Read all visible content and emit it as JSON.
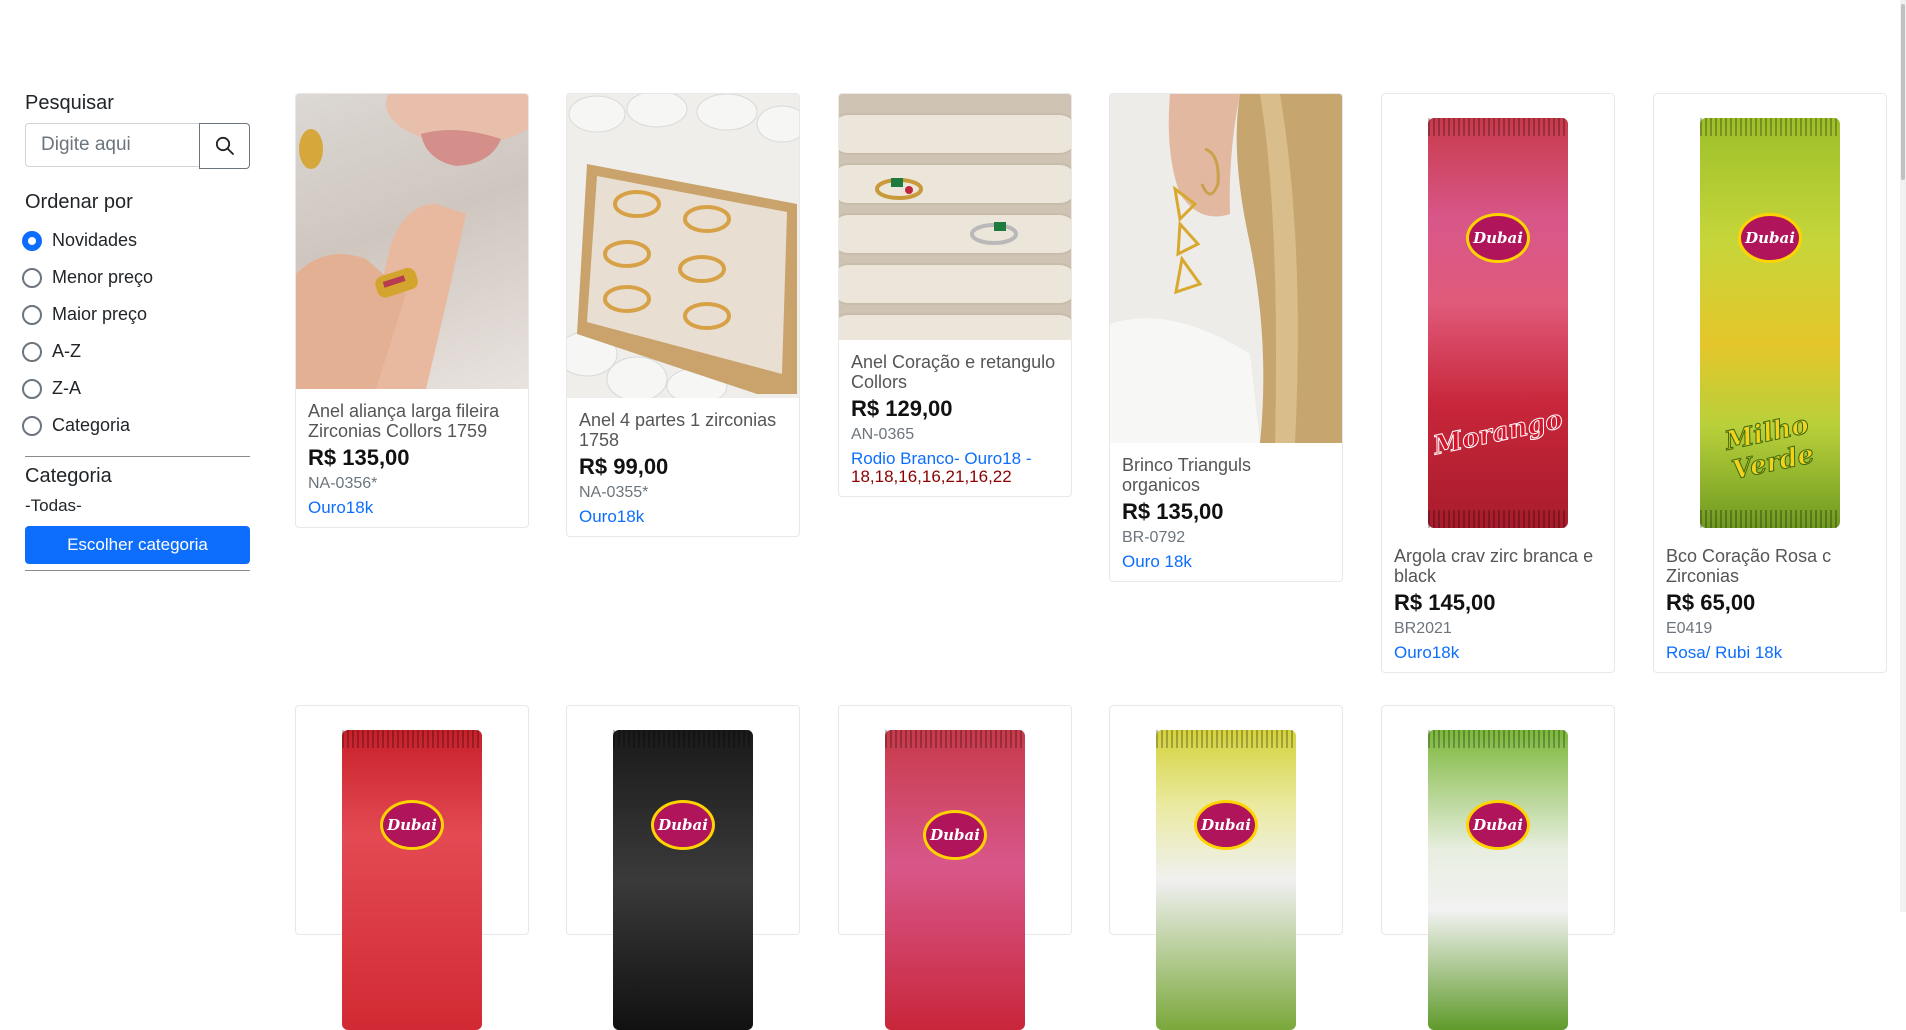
{
  "sidebar": {
    "search_heading": "Pesquisar",
    "search_placeholder": "Digite aqui",
    "sort_heading": "Ordenar por",
    "sort_options": [
      "Novidades",
      "Menor preço",
      "Maior preço",
      "A-Z",
      "Z-A",
      "Categoria"
    ],
    "sort_selected": "Novidades",
    "category_heading": "Categoria",
    "category_current": "-Todas-",
    "category_button": "Escolher categoria"
  },
  "products": [
    {
      "name": "Anel aliança larga fileira Zirconias Collors 1759",
      "price": "R$ 135,00",
      "code": "NA-0356*",
      "variation": "Ouro18k",
      "image": "hand-ring-photo"
    },
    {
      "name": "Anel 4 partes 1 zirconias 1758",
      "price": "R$ 99,00",
      "code": "NA-0355*",
      "variation": "Ouro18k",
      "image": "rings-display-photo"
    },
    {
      "name": "Anel Coração e retangulo Collors",
      "price": "R$ 129,00",
      "code": "AN-0365",
      "variation": "Rodio Branco- Ouro18",
      "variation_sizes": "18,18,16,16,21,16,22",
      "image": "rings-cushion-photo"
    },
    {
      "name": "Brinco Trianguls organicos",
      "price": "R$ 135,00",
      "code": "BR-0792",
      "variation": "Ouro 18k",
      "image": "earring-photo"
    },
    {
      "name": "Argola crav zirc branca e black",
      "price": "R$ 145,00",
      "code": "BR2021",
      "variation": "Ouro18k",
      "image": "dubai-morango-pack"
    },
    {
      "name": "Bco Coração Rosa c Zirconias",
      "price": "R$ 65,00",
      "code": "E0419",
      "variation": "Rosa/ Rubi 18k",
      "image": "dubai-milho-verde-pack"
    }
  ],
  "packs": {
    "brand": "Dubai",
    "morango": "Morango",
    "milho_verde": "Milho Verde"
  },
  "colors": {
    "primary": "#0d6efd",
    "sizes_text": "#8b0000"
  }
}
